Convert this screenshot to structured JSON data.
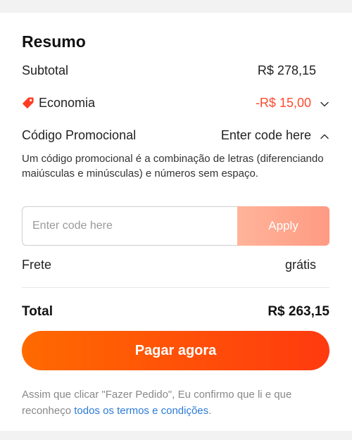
{
  "summary": {
    "title": "Resumo",
    "subtotal_label": "Subtotal",
    "subtotal_value": "R$ 278,15",
    "economia_label": "Economia",
    "economia_value": "-R$ 15,00",
    "promo_label": "Código Promocional",
    "promo_toggle": "Enter code here",
    "promo_description": "Um código promocional é a combinação de letras (diferenciando maiúsculas e minúsculas) e números sem espaço.",
    "promo_input_placeholder": "Enter code here",
    "promo_input_value": "",
    "apply_label": "Apply",
    "frete_label": "Frete",
    "frete_value": "grátis",
    "total_label": "Total",
    "total_value": "R$ 263,15",
    "pay_label": "Pagar agora",
    "terms_text": "Assim que clicar \"Fazer Pedido\", Eu confirmo que li e que reconheço ",
    "terms_link": "todos os termos e condições",
    "terms_end": "."
  },
  "icons": {
    "economia_icon": "tag-icon",
    "economia_toggle_icon": "chevron-down-icon",
    "promo_toggle_icon": "chevron-up-icon"
  },
  "colors": {
    "accent": "#ff4a2f",
    "pay_gradient_start": "#ff6a00",
    "pay_gradient_end": "#ff3a0f",
    "apply_button": "#ffa98f",
    "link": "#2d7bd6"
  }
}
